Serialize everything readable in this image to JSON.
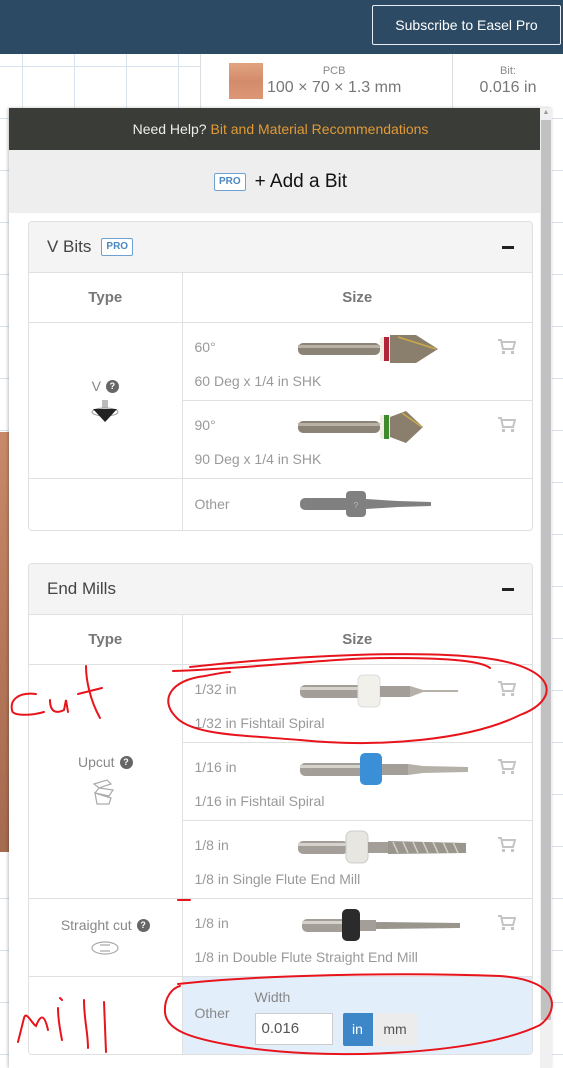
{
  "topbar": {
    "subscribe_label": "Subscribe to Easel Pro"
  },
  "infobar": {
    "material_name": "PCB",
    "material_dims": "100 × 70 × 1.3 mm",
    "material_color": "#d8936f",
    "bit_label": "Bit:",
    "bit_value": "0.016 in"
  },
  "panel": {
    "help_prefix": "Need Help?",
    "help_link": "Bit and Material Recommendations",
    "pro_badge": "PRO",
    "add_bit_label": "+ Add a Bit",
    "sections": [
      {
        "title": "V Bits",
        "pro_badge": "PRO",
        "col_type": "Type",
        "col_size": "Size",
        "groups": [
          {
            "type_name": "V",
            "type_icon": "v-bit-icon",
            "bits": [
              {
                "size": "60°",
                "description": "60 Deg x 1/4 in SHK",
                "collar_color": "#b3243a"
              },
              {
                "size": "90°",
                "description": "90 Deg x 1/4 in SHK",
                "collar_color": "#3f8a2c"
              }
            ]
          }
        ],
        "other_label": "Other"
      },
      {
        "title": "End Mills",
        "col_type": "Type",
        "col_size": "Size",
        "groups": [
          {
            "type_name": "Upcut",
            "type_icon": "upcut-icon",
            "bits": [
              {
                "size": "1/32 in",
                "description": "1/32 in Fishtail Spiral",
                "collar_color": "#f2f0ea"
              },
              {
                "size": "1/16 in",
                "description": "1/16 in Fishtail Spiral",
                "collar_color": "#3a8fd6"
              },
              {
                "size": "1/8 in",
                "description": "1/8 in Single Flute End Mill",
                "collar_color": "#e8e6e0"
              }
            ]
          },
          {
            "type_name": "Straight cut",
            "type_icon": "straight-cut-icon",
            "bits": [
              {
                "size": "1/8 in",
                "description": "1/8 in Double Flute Straight End Mill",
                "collar_color": "#2b2b2b"
              }
            ]
          }
        ],
        "custom": {
          "other_label": "Other",
          "width_label": "Width",
          "width_value": "0.016",
          "unit_in": "in",
          "unit_mm": "mm",
          "selected_unit": "in"
        }
      }
    ]
  },
  "annotations": {
    "text_1": "cut",
    "text_2": "mill",
    "color": "#e8141c"
  }
}
